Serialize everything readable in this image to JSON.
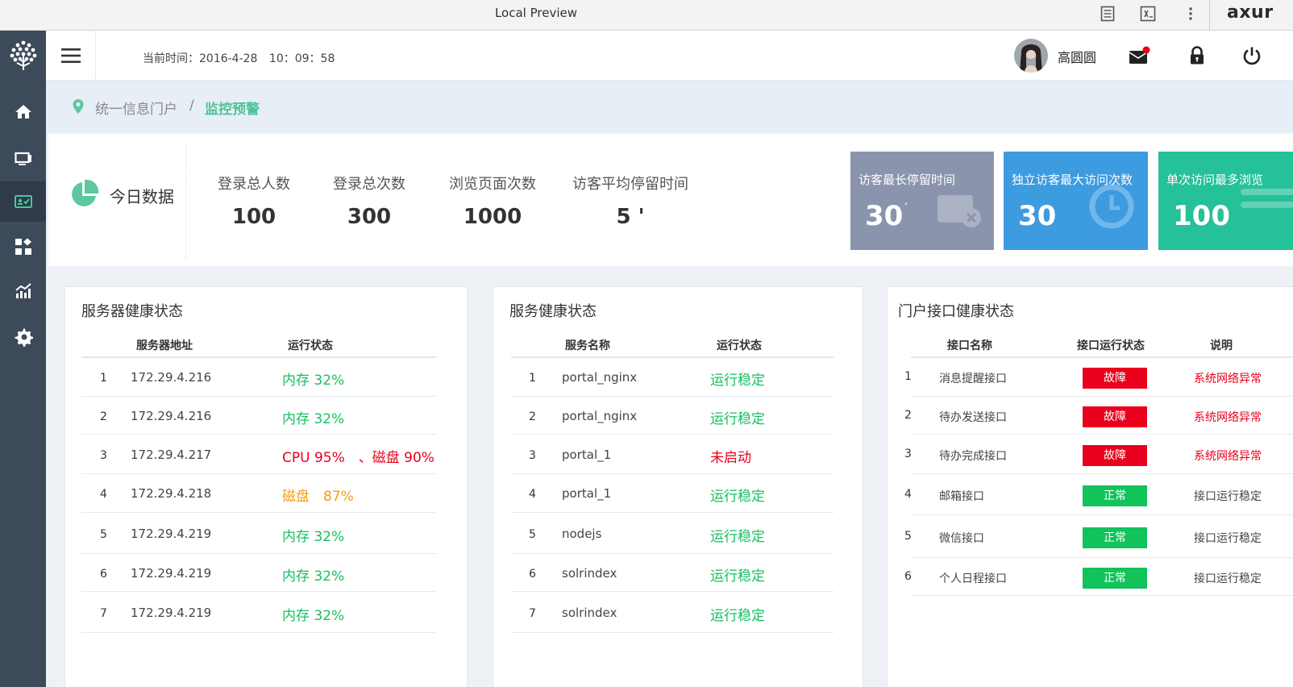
{
  "browser": {
    "title": "Local Preview",
    "brand": "axur"
  },
  "header": {
    "time_label": "当前时间：2016-4-28",
    "time_value": "10：09：58",
    "user_name": "高圆圆"
  },
  "breadcrumb": {
    "home": "统一信息门户",
    "separator": "/",
    "current": "监控预警"
  },
  "today": {
    "label": "今日数据",
    "stats": [
      {
        "label": "登录总人数",
        "value": "100"
      },
      {
        "label": "登录总次数",
        "value": "300"
      },
      {
        "label": "浏览页面次数",
        "value": "1000"
      },
      {
        "label": "访客平均停留时间",
        "value": "5 '"
      }
    ],
    "cards": [
      {
        "title": "访客最长停留时间",
        "value": "30",
        "suffix": "′",
        "color": "#8a94ad"
      },
      {
        "title": "独立访客最大访问次数",
        "value": "30",
        "suffix": "",
        "color": "#3d9be0"
      },
      {
        "title": "单次访问最多浏览",
        "value": "100",
        "suffix": "",
        "color": "#25c199"
      }
    ]
  },
  "servers": {
    "title": "服务器健康状态",
    "col_addr": "服务器地址",
    "col_status": "运行状态",
    "rows": [
      {
        "idx": "1",
        "addr": "172.29.4.216",
        "status": "内存 32%",
        "level": "green"
      },
      {
        "idx": "2",
        "addr": "172.29.4.216",
        "status": "内存 32%",
        "level": "green"
      },
      {
        "idx": "3",
        "addr": "172.29.4.217",
        "status": "CPU 95%　、磁盘 90%",
        "level": "red"
      },
      {
        "idx": "4",
        "addr": "172.29.4.218",
        "status": "磁盘　87%",
        "level": "orange"
      },
      {
        "idx": "5",
        "addr": "172.29.4.219",
        "status": "内存 32%",
        "level": "green"
      },
      {
        "idx": "6",
        "addr": "172.29.4.219",
        "status": "内存 32%",
        "level": "green"
      },
      {
        "idx": "7",
        "addr": "172.29.4.219",
        "status": "内存 32%",
        "level": "green"
      }
    ]
  },
  "services": {
    "title": "服务健康状态",
    "col_name": "服务名称",
    "col_status": "运行状态",
    "rows": [
      {
        "idx": "1",
        "name": "portal_nginx",
        "status": "运行稳定",
        "level": "green"
      },
      {
        "idx": "2",
        "name": "portal_nginx",
        "status": "运行稳定",
        "level": "green"
      },
      {
        "idx": "3",
        "name": "portal_1",
        "status": "未启动",
        "level": "red"
      },
      {
        "idx": "4",
        "name": "portal_1",
        "status": "运行稳定",
        "level": "green"
      },
      {
        "idx": "5",
        "name": "nodejs",
        "status": "运行稳定",
        "level": "green"
      },
      {
        "idx": "6",
        "name": "solrindex",
        "status": "运行稳定",
        "level": "green"
      },
      {
        "idx": "7",
        "name": "solrindex",
        "status": "运行稳定",
        "level": "green"
      }
    ]
  },
  "interfaces": {
    "title": "门户接口健康状态",
    "col_name": "接口名称",
    "col_status": "接口运行状态",
    "col_note": "说明",
    "rows": [
      {
        "idx": "1",
        "name": "消息提醒接口",
        "status": "故障",
        "kind": "fault",
        "note": "系统网络异常"
      },
      {
        "idx": "2",
        "name": "待办发送接口",
        "status": "故障",
        "kind": "fault",
        "note": "系统网络异常"
      },
      {
        "idx": "3",
        "name": "待办完成接口",
        "status": "故障",
        "kind": "fault",
        "note": "系统网络异常"
      },
      {
        "idx": "4",
        "name": "邮箱接口",
        "status": "正常",
        "kind": "ok",
        "note": "接口运行稳定"
      },
      {
        "idx": "5",
        "name": "微信接口",
        "status": "正常",
        "kind": "ok",
        "note": "接口运行稳定"
      },
      {
        "idx": "6",
        "name": "个人日程接口",
        "status": "正常",
        "kind": "ok",
        "note": "接口运行稳定"
      }
    ]
  }
}
